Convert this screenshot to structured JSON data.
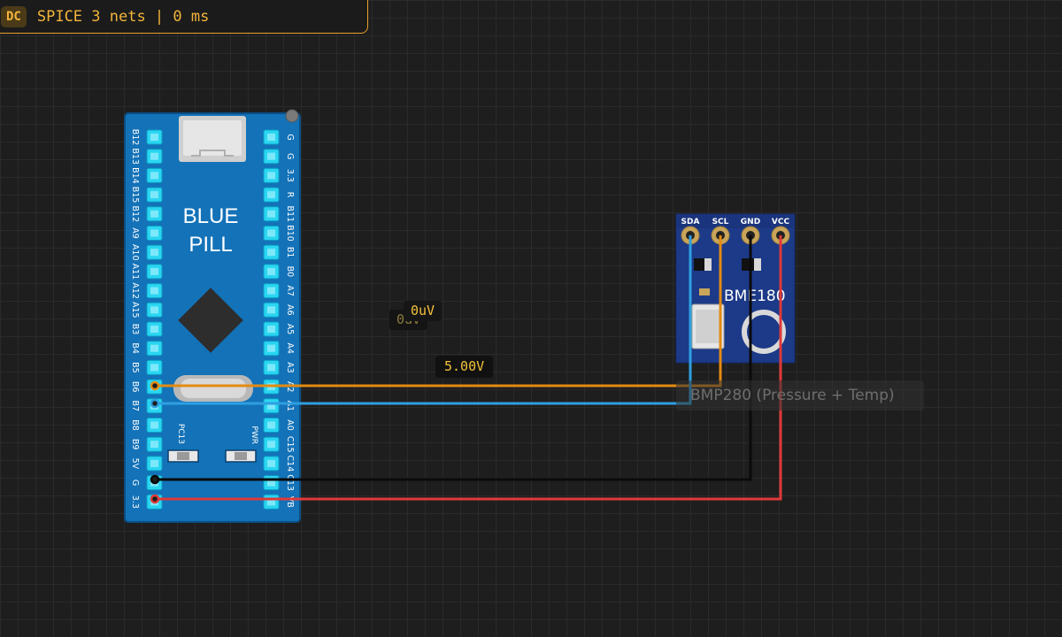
{
  "status": {
    "mode": "DC",
    "text": "SPICE 3 nets | 0 ms"
  },
  "blue_pill": {
    "title_line1": "BLUE",
    "title_line2": "PILL",
    "left_pins": [
      "B12",
      "B13",
      "B14",
      "B15",
      "B12",
      "A9",
      "A10",
      "A11",
      "A12",
      "A15",
      "B3",
      "B4",
      "B5",
      "B6",
      "B7",
      "B8",
      "B9",
      "5V",
      "G",
      "3.3"
    ],
    "right_pins": [
      "G",
      "G",
      "3.3",
      "R",
      "B11",
      "B10",
      "B1",
      "B0",
      "A7",
      "A6",
      "A5",
      "A4",
      "A3",
      "A2",
      "A1",
      "A0",
      "C15",
      "C14",
      "C13",
      "VB"
    ],
    "led_labels": [
      "PC13",
      "PWR"
    ]
  },
  "bmp_module": {
    "pins": [
      "SDA",
      "SCL",
      "GND",
      "VCC"
    ],
    "chip_text": "BME180",
    "caption": "BMP280 (Pressure + Temp)"
  },
  "probes": [
    {
      "id": "probe-front",
      "value": "0uV"
    },
    {
      "id": "probe-back",
      "value": "0uV"
    },
    {
      "id": "probe-vcc",
      "value": "5.00V"
    }
  ],
  "wire_colors": {
    "SCL": "#e38b12",
    "SDA": "#2e9fe0",
    "GND": "#0a0a0a",
    "VCC": "#e0393a"
  }
}
